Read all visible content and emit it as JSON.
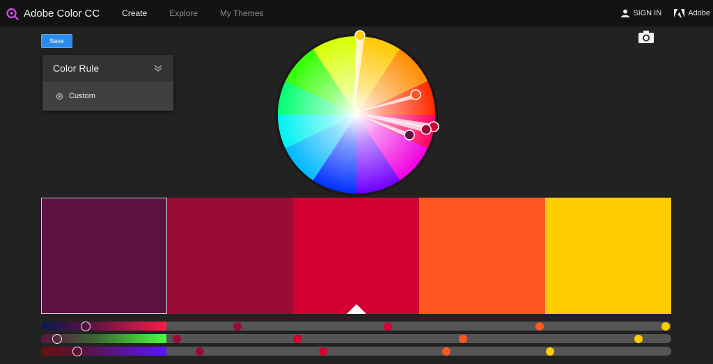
{
  "app": {
    "title": "Adobe Color CC",
    "nav": [
      {
        "label": "Create",
        "active": true
      },
      {
        "label": "Explore",
        "active": false
      },
      {
        "label": "My Themes",
        "active": false
      }
    ],
    "sign_in": "SIGN IN",
    "adobe": "Adobe",
    "icons": {
      "logo": "color-wheel-logo-icon",
      "user": "user-icon",
      "adobe_logo": "adobe-logo-icon",
      "camera": "camera-icon",
      "chevron": "double-chevron-down-icon"
    }
  },
  "toolbar": {
    "save_label": "Save"
  },
  "color_rule": {
    "title": "Color Rule",
    "selected_option": "Custom"
  },
  "swatches": [
    {
      "color": "#5c1342",
      "selected": true,
      "base": false
    },
    {
      "color": "#9c0a36",
      "selected": false,
      "base": false
    },
    {
      "color": "#d40032",
      "selected": false,
      "base": true
    },
    {
      "color": "#ff5722",
      "selected": false,
      "base": false
    },
    {
      "color": "#ffcc00",
      "selected": false,
      "base": false
    }
  ],
  "accent": "#2d8ceb"
}
